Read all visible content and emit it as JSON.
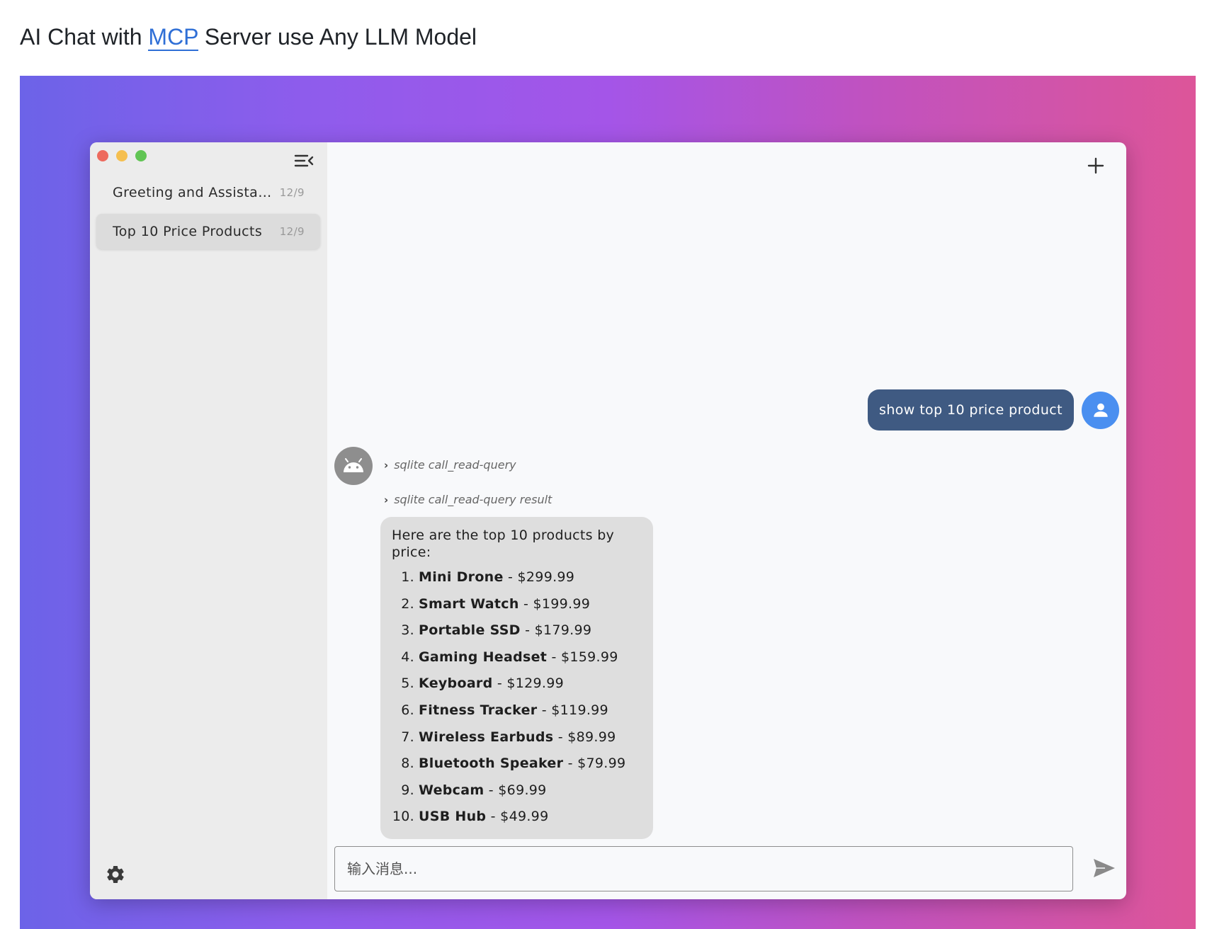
{
  "heading": {
    "prefix": "AI Chat with ",
    "link": "MCP",
    "suffix": " Server use Any LLM Model"
  },
  "sidebar": {
    "conversations": [
      {
        "title": "Greeting and Assistan...",
        "date": "12/9",
        "active": false
      },
      {
        "title": "Top 10 Price Products",
        "date": "12/9",
        "active": true
      }
    ]
  },
  "chat": {
    "user_message": "show top 10 price product",
    "tool_calls": [
      "sqlite call_read-query",
      "sqlite call_read-query result"
    ],
    "bot_intro": "Here are the top 10 products by price:",
    "products": [
      {
        "num": "1.",
        "name": "Mini Drone",
        "price": " - $299.99"
      },
      {
        "num": "2.",
        "name": "Smart Watch",
        "price": " - $199.99"
      },
      {
        "num": "3.",
        "name": "Portable SSD",
        "price": " - $179.99"
      },
      {
        "num": "4.",
        "name": "Gaming Headset",
        "price": " - $159.99"
      },
      {
        "num": "5.",
        "name": "Keyboard",
        "price": " - $129.99"
      },
      {
        "num": "6.",
        "name": "Fitness Tracker",
        "price": " - $119.99"
      },
      {
        "num": "7.",
        "name": "Wireless Earbuds",
        "price": " - $89.99"
      },
      {
        "num": "8.",
        "name": "Bluetooth Speaker",
        "price": " - $79.99"
      },
      {
        "num": "9.",
        "name": "Webcam",
        "price": " - $69.99"
      },
      {
        "num": "10.",
        "name": "USB Hub",
        "price": " - $49.99"
      }
    ]
  },
  "input": {
    "placeholder": "输入消息...",
    "value": ""
  },
  "icons": {
    "collapse": "collapse-sidebar-icon",
    "new_chat": "plus-icon",
    "settings": "gear-icon",
    "user": "user-icon",
    "bot": "android-icon",
    "send": "send-icon"
  },
  "colors": {
    "accent": "#4a8ff0",
    "user_bubble": "#3f5a82",
    "bot_bubble": "#dedede",
    "gradient_start": "#6c63e8",
    "gradient_end": "#dd5599",
    "link": "#2f6fd6"
  }
}
